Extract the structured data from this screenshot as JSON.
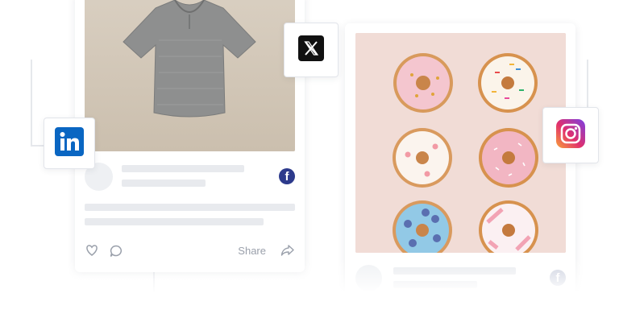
{
  "post1": {
    "share_label": "Share",
    "facebook_glyph": "f",
    "icons": [
      "heart-icon",
      "comment-icon",
      "share-icon"
    ]
  },
  "post2": {
    "facebook_glyph": "f"
  },
  "social_badges": [
    "x-logo",
    "linkedin-logo",
    "instagram-logo"
  ],
  "colors": {
    "facebook": "#2d3a8c",
    "linkedin": "#0a66c2",
    "x": "#111111",
    "placeholder": "#e8eaee"
  }
}
